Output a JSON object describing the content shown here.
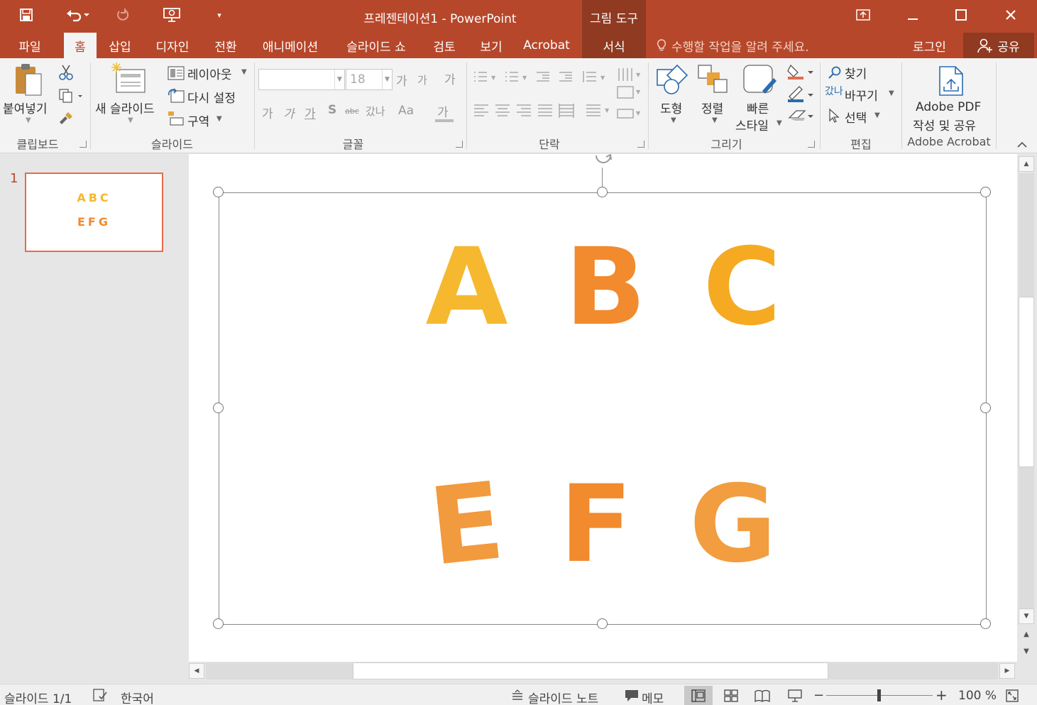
{
  "app": {
    "doc_title": "프레젠테이션1  -  PowerPoint",
    "context_tool_group": "그림 도구"
  },
  "tabs": [
    {
      "label": "파일"
    },
    {
      "label": "홈"
    },
    {
      "label": "삽입"
    },
    {
      "label": "디자인"
    },
    {
      "label": "전환"
    },
    {
      "label": "애니메이션"
    },
    {
      "label": "슬라이드 쇼"
    },
    {
      "label": "검토"
    },
    {
      "label": "보기"
    },
    {
      "label": "Acrobat"
    },
    {
      "label": "서식"
    }
  ],
  "tell_me": "수행할 작업을 알려 주세요.",
  "login": "로그인",
  "share": "공유",
  "ribbon": {
    "clipboard": {
      "paste": "붙여넣기",
      "label": "클립보드"
    },
    "slides": {
      "new_slide": "새 슬라이드",
      "layout": "레이아웃",
      "reset": "다시 설정",
      "section": "구역",
      "label": "슬라이드"
    },
    "font": {
      "size": "18",
      "grow": "가",
      "shrink": "가",
      "clear": "가",
      "bold": "가",
      "italic": "가",
      "underline": "가",
      "shadow": "S",
      "strike": "abc",
      "spacing": "갔나",
      "case": "Aa",
      "color": "가",
      "label": "글꼴"
    },
    "paragraph": {
      "label": "단락"
    },
    "drawing": {
      "shapes": "도형",
      "arrange": "정렬",
      "quick_styles_1": "빠른",
      "quick_styles_2": "스타일",
      "label": "그리기"
    },
    "editing": {
      "find": "찾기",
      "replace": "바꾸기",
      "select": "선택",
      "replace_icon": "갔나",
      "label": "편집"
    },
    "acrobat": {
      "line1": "Adobe PDF",
      "line2": "작성 및 공유",
      "label": "Adobe Acrobat"
    }
  },
  "thumbnails": [
    {
      "number": "1",
      "line1": "ABC",
      "line2": "EFG"
    }
  ],
  "slide": {
    "line1": [
      "A",
      "B",
      "C"
    ],
    "line2": [
      "E",
      "F",
      "G"
    ]
  },
  "status": {
    "slide_count": "슬라이드 1/1",
    "language": "한국어",
    "notes": "슬라이드 노트",
    "comments": "메모",
    "zoom": "100 %"
  },
  "colors": {
    "brand": "#b7472a",
    "letter_yellow": "#f5b82e",
    "letter_orange": "#f28a2e"
  }
}
